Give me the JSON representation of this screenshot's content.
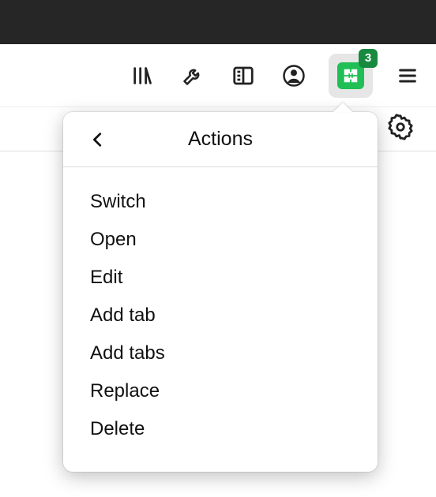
{
  "toolbar": {
    "extension_badge": "3"
  },
  "popover": {
    "title": "Actions",
    "items": [
      {
        "label": "Switch"
      },
      {
        "label": "Open"
      },
      {
        "label": "Edit"
      },
      {
        "label": "Add tab"
      },
      {
        "label": "Add tabs"
      },
      {
        "label": "Replace"
      },
      {
        "label": "Delete"
      }
    ]
  }
}
